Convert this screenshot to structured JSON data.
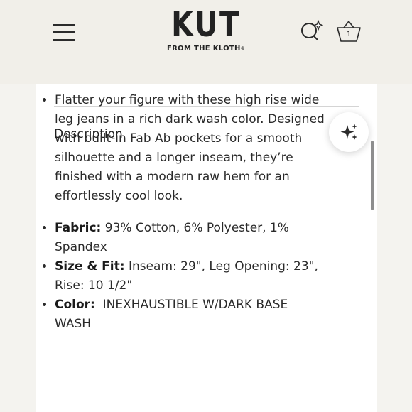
{
  "header": {
    "logo_main": "KUT",
    "logo_sub": "FROM THE KLOTH",
    "logo_reg": "®",
    "cart_count": "1"
  },
  "icons": {
    "menu": "hamburger-menu-icon",
    "search": "search-sparkle-icon",
    "cart": "basket-icon",
    "assistant": "sparkles-icon"
  },
  "colors": {
    "header_bg": "#f1efe9",
    "panel_bg": "#ffffff",
    "text": "#1f1f1f"
  },
  "description": {
    "heading": "Description",
    "intro": "Flatter your figure with these high rise wide leg jeans in a rich dark wash color. Designed with built-in Fab Ab pockets for a smooth silhouette and a longer inseam, they’re finished with a modern raw hem for an effortlessly cool look.",
    "specs": [
      {
        "label": "Fabric:",
        "value": "93% Cotton, 6% Polyester, 1% Spandex"
      },
      {
        "label": "Size & Fit:",
        "value": "Inseam: 29\", Leg Opening: 23\", Rise: 10 1/2\""
      },
      {
        "label": "Color:",
        "value": "INEXHAUSTIBLE W/DARK BASE WASH"
      }
    ]
  }
}
